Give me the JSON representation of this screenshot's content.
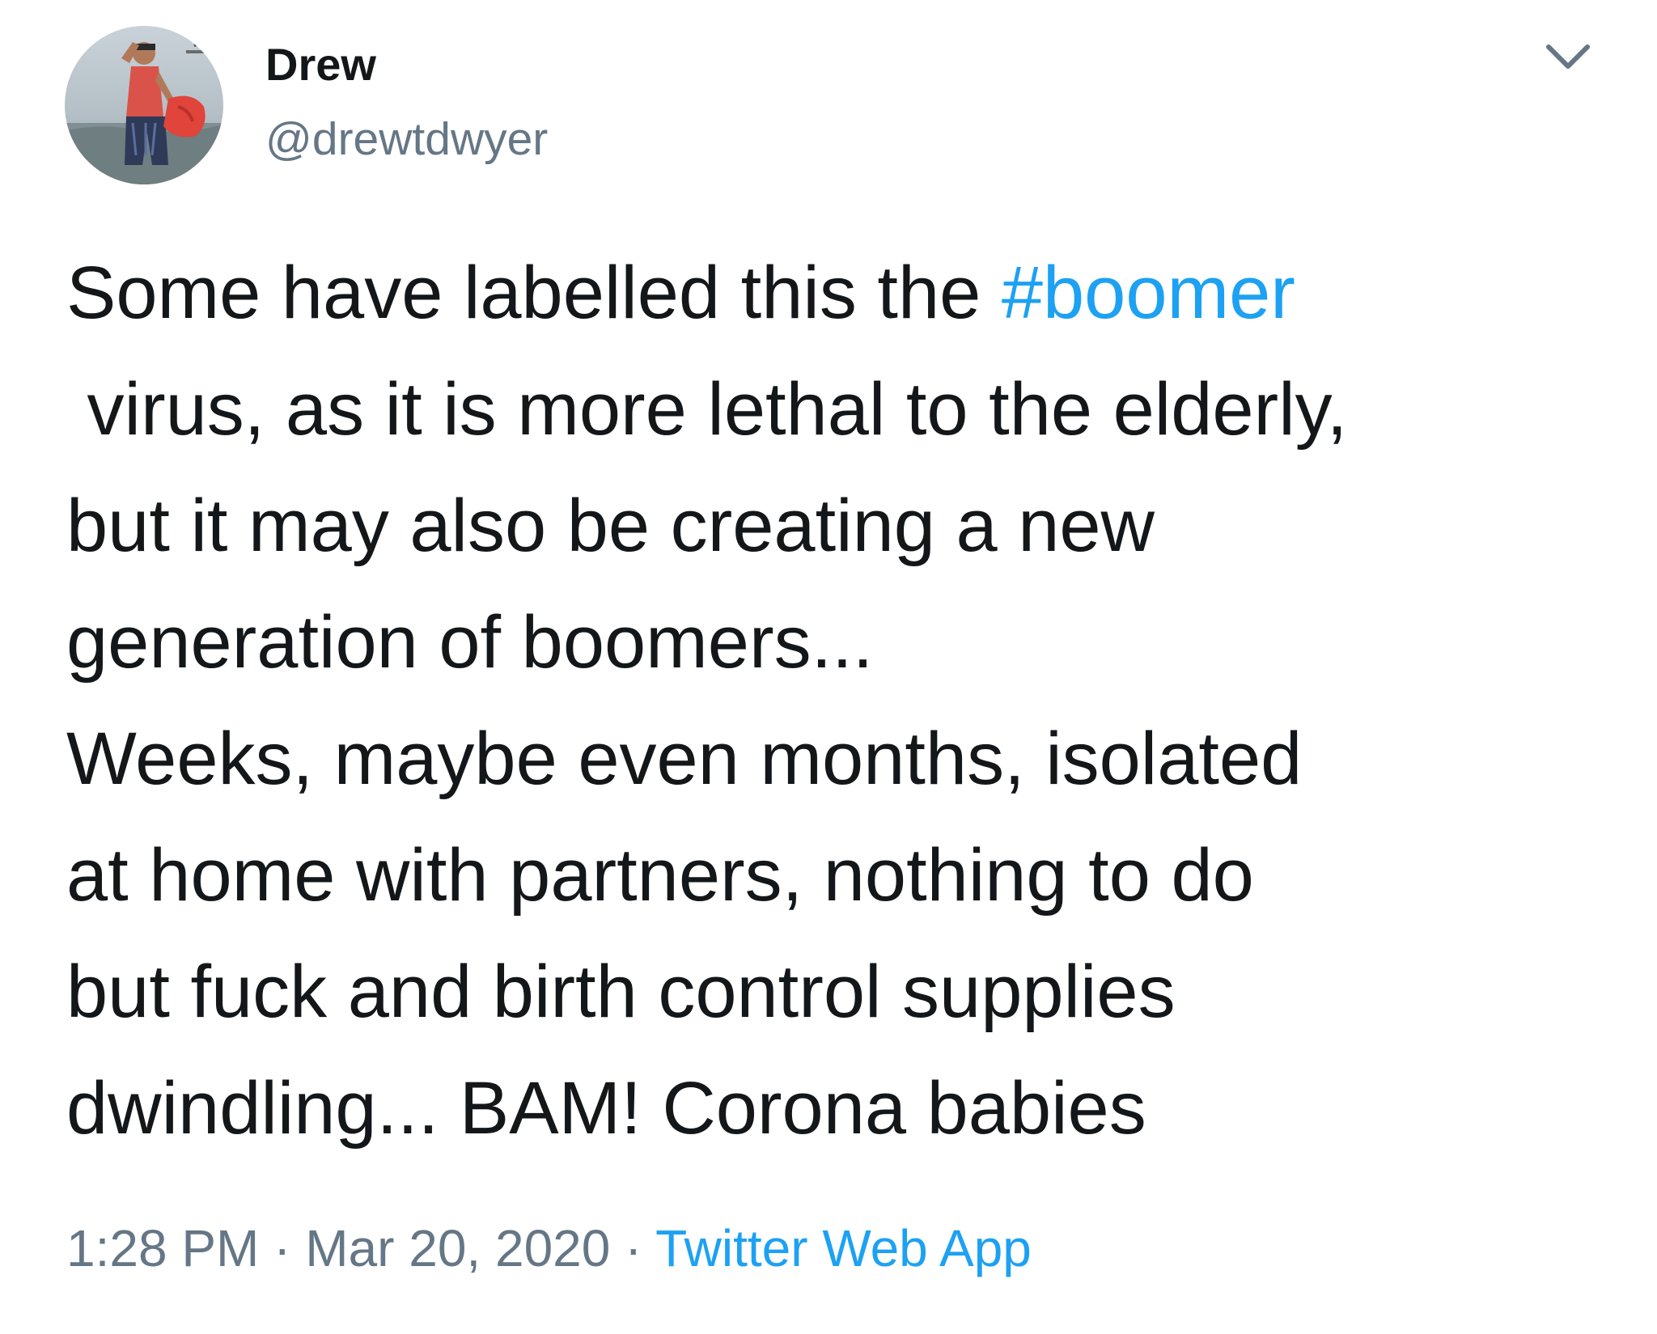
{
  "tweet": {
    "author": {
      "name": "Drew",
      "handle": "@drewtdwyer",
      "avatar": "profile-photo"
    },
    "menu_icon": "chevron-down-icon",
    "text_lines": [
      {
        "before": "Some have labelled this the ",
        "hashtag": "#boomer"
      },
      {
        "text": " virus, as it is more lethal to the elderly,"
      },
      {
        "text": "but it may also be creating a new"
      },
      {
        "text": "generation of boomers..."
      },
      {
        "text": "Weeks, maybe even months, isolated"
      },
      {
        "text": "at home with partners, nothing to do"
      },
      {
        "text": "but fuck and birth control supplies"
      },
      {
        "text": "dwindling... BAM! Corona babies"
      }
    ],
    "time": "1:28 PM",
    "separator": " · ",
    "date": "Mar 20, 2020",
    "source": "Twitter Web App"
  },
  "colors": {
    "text": "#14171a",
    "secondary": "#657786",
    "link": "#1da1f2"
  }
}
